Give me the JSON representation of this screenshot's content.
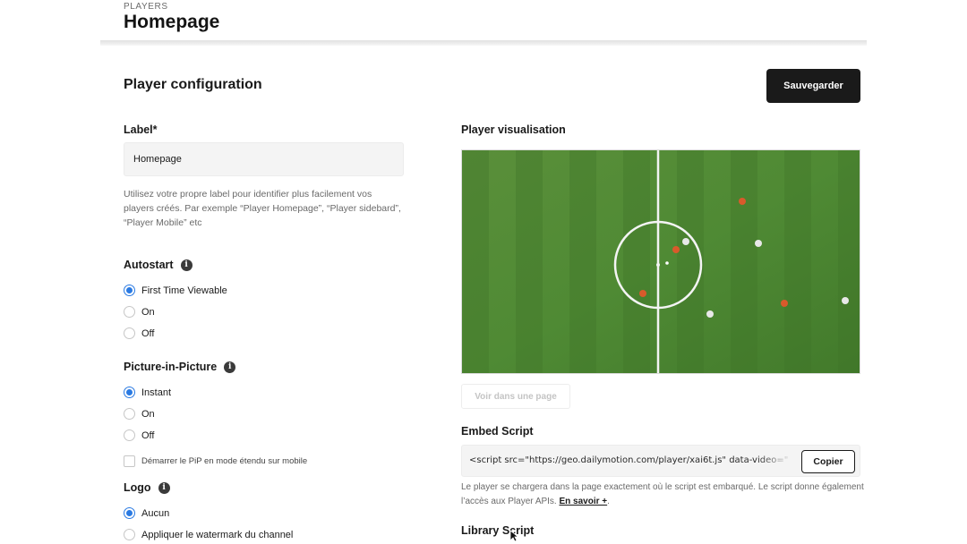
{
  "header": {
    "breadcrumb": "PLAYERS",
    "title": "Homepage"
  },
  "config": {
    "title": "Player configuration",
    "save_label": "Sauvegarder",
    "label_field": {
      "label": "Label*",
      "value": "Homepage",
      "help": "Utilisez votre propre label pour identifier plus facilement vos players créés. Par exemple “Player Homepage”, “Player sidebard”, “Player Mobile” etc"
    },
    "autostart": {
      "title": "Autostart",
      "options": [
        "First Time Viewable",
        "On",
        "Off"
      ],
      "selected": "First Time Viewable"
    },
    "pip": {
      "title": "Picture-in-Picture",
      "options": [
        "Instant",
        "On",
        "Off"
      ],
      "selected": "Instant",
      "checkbox_label": "Démarrer le PiP en mode étendu sur mobile"
    },
    "logo": {
      "title": "Logo",
      "options": [
        "Aucun",
        "Appliquer le watermark du channel"
      ],
      "selected": "Aucun"
    }
  },
  "visualisation": {
    "title": "Player visualisation",
    "view_button": "Voir dans une page"
  },
  "embed": {
    "title": "Embed Script",
    "code": "<script src=\"https://geo.dailymotion.com/player/xai6t.js\" data-video=\"",
    "copy_label": "Copier",
    "help_text": "Le player se chargera dans la page exactement où le script est embarqué. Le script donne également l’accès aux Player APIs. ",
    "help_link": "En savoir +",
    "help_end": "."
  },
  "library": {
    "title": "Library Script"
  },
  "icons": {
    "info": "info-icon",
    "cursor": "cursor-icon"
  },
  "colors": {
    "accent": "#2a7ae2",
    "button_dark": "#1a1a1a",
    "pitch": "#4f8a34"
  }
}
